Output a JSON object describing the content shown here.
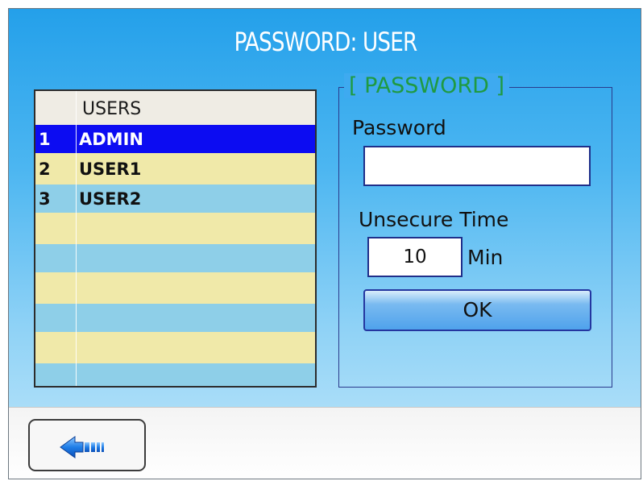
{
  "header": {
    "title": "PASSWORD: USER"
  },
  "users_table": {
    "column_header": "USERS",
    "rows": [
      {
        "num": "1",
        "name": "ADMIN",
        "selected": true
      },
      {
        "num": "2",
        "name": "USER1",
        "selected": false
      },
      {
        "num": "3",
        "name": "USER2",
        "selected": false
      }
    ]
  },
  "password_group": {
    "legend": "[ PASSWORD ]",
    "password_label": "Password",
    "password_value": "",
    "unsecure_time_label": "Unsecure Time",
    "unsecure_time_value": "10",
    "unit_label": "Min",
    "ok_label": "OK"
  },
  "bottom_bar": {
    "back_icon": "back-arrow-icon"
  },
  "colors": {
    "selected_row": "#0c0cf2",
    "row_yellow": "#f0e9a9",
    "row_blue": "#8ecfe8",
    "legend_green": "#1f9a42",
    "title_text": "#ffffff"
  }
}
